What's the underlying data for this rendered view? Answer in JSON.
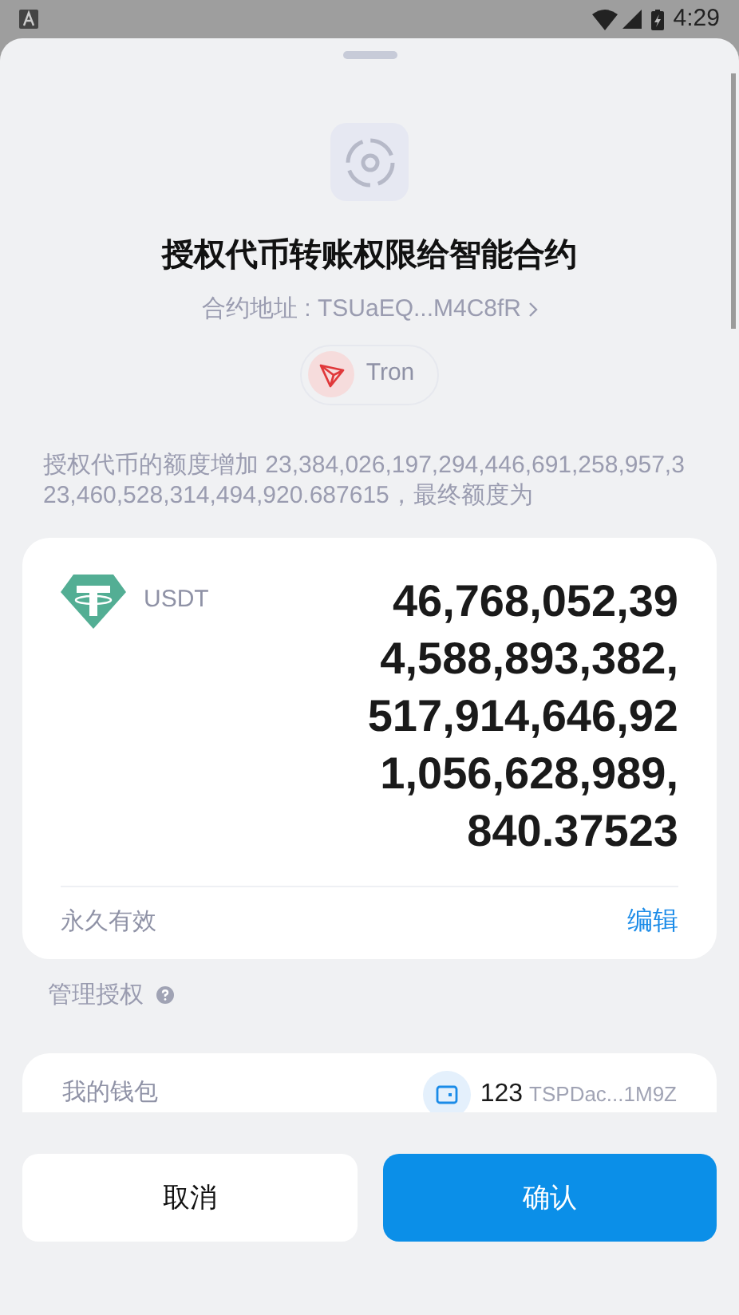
{
  "status_bar": {
    "time": "4:29"
  },
  "title": "授权代币转账权限给智能合约",
  "contract_address": {
    "label": "合约地址 : TSUaEQ...M4C8fR"
  },
  "network": {
    "name": "Tron"
  },
  "description": "授权代币的额度增加 23,384,026,197,294,446,691,258,957,323,460,528,314,494,920.687615，最终额度为",
  "allowance_card": {
    "token": "USDT",
    "amount": "46,768,052,394,588,893,382,517,914,646,921,056,628,989,840.37523",
    "validity": "永久有效",
    "edit": "编辑"
  },
  "manage": {
    "label": "管理授权"
  },
  "wallet": {
    "label": "我的钱包",
    "name": "123",
    "address": "TSPDac...1M9Z"
  },
  "buttons": [
    {
      "label": "取消",
      "kind": "secondary"
    },
    {
      "label": "确认",
      "kind": "primary"
    }
  ]
}
